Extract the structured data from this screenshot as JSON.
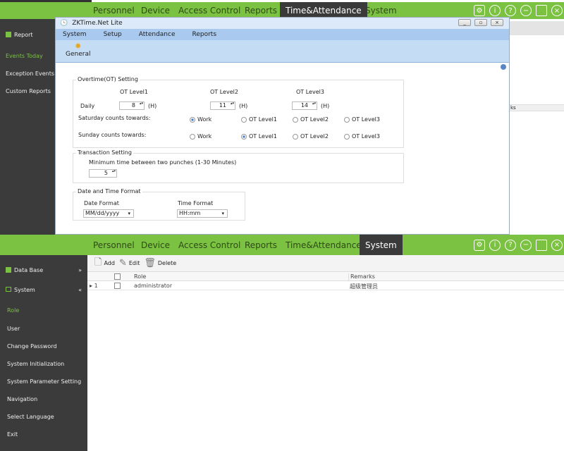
{
  "top_app": {
    "nav": [
      "Personnel",
      "Device",
      "Access Control",
      "Reports",
      "Time&Attendance",
      "System"
    ],
    "active_tab": "Time&Attendance",
    "sidebar": {
      "section": "Report",
      "items": [
        "Events Today",
        "Exception Events",
        "Custom Reports"
      ],
      "active": "Events Today"
    },
    "bg_column_fragment": "ks"
  },
  "dialog": {
    "title": "ZKTime.Net Lite",
    "menu": [
      "System",
      "Setup",
      "Attendance",
      "Reports"
    ],
    "toolbar": {
      "general": "General"
    },
    "ot": {
      "legend": "Overtime(OT) Setting",
      "levels": [
        "OT Level1",
        "OT Level2",
        "OT Level3"
      ],
      "daily_label": "Daily",
      "daily_values": [
        "8",
        "11",
        "14"
      ],
      "unit": "(H)",
      "saturday_label": "Saturday counts towards:",
      "sunday_label": "Sunday counts towards:",
      "options": [
        "Work",
        "OT Level1",
        "OT Level2",
        "OT Level3"
      ],
      "saturday_selected": "Work",
      "sunday_selected": "OT Level1"
    },
    "transaction": {
      "legend": "Transaction Setting",
      "label": "Minimum time between two punches (1-30 Minutes)",
      "value": "5"
    },
    "datetime": {
      "legend": "Date and Time Format",
      "date_label": "Date Format",
      "date_value": "MM/dd/yyyy",
      "time_label": "Time Format",
      "time_value": "HH:mm"
    }
  },
  "bottom_app": {
    "nav": [
      "Personnel",
      "Device",
      "Access Control",
      "Reports",
      "Time&Attendance",
      "System"
    ],
    "active_tab": "System",
    "sidebar": {
      "groups": [
        "Data Base",
        "System"
      ],
      "items": [
        "Role",
        "User",
        "Change Password",
        "System Initialization",
        "System Parameter Setting",
        "Navigation",
        "Select Language",
        "Exit"
      ],
      "active": "Role"
    },
    "toolbar": {
      "add": "Add",
      "edit": "Edit",
      "delete": "Delete"
    },
    "table": {
      "columns": [
        "Role",
        "Remarks"
      ],
      "rows": [
        {
          "index": "1",
          "role": "administrator",
          "remarks": "超级管理员"
        }
      ]
    }
  },
  "colors": {
    "accent": "#7cc242",
    "sidebar": "#3b3b3b",
    "dialog_header": "#c5dcf5"
  }
}
